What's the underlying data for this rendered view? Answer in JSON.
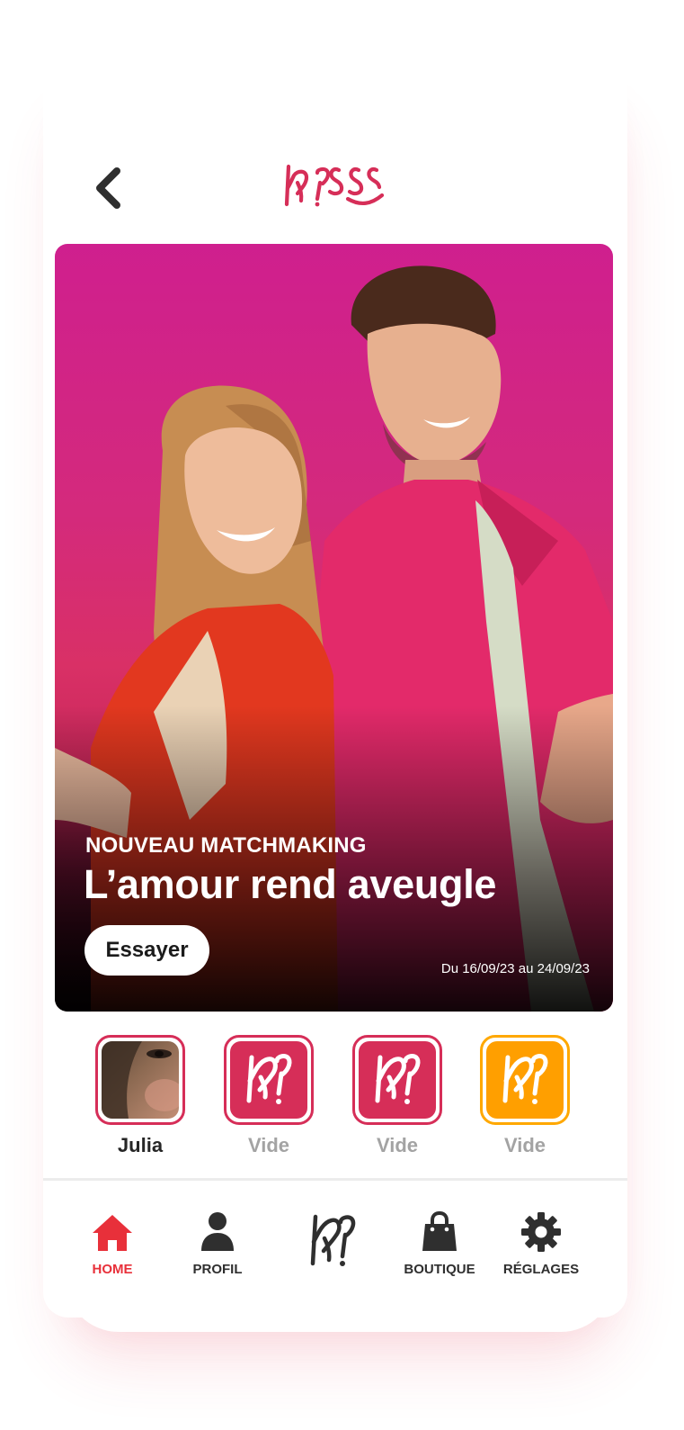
{
  "app": {
    "brand": "KISS"
  },
  "colors": {
    "brand_pink": "#d62e58",
    "active_red": "#e8303a",
    "icon_dark": "#2f2f2f",
    "muted_gray": "#a3a3a3",
    "slot_orange": "#ff9f00"
  },
  "header": {
    "back_icon": "chevron-left-icon",
    "logo_icon": "kiss-logo"
  },
  "banner": {
    "kicker": "NOUVEAU MATCHMAKING",
    "headline": "L’amour rend aveugle",
    "cta_label": "Essayer",
    "dates": "Du 16/09/23 au 24/09/23"
  },
  "slots": [
    {
      "label": "Julia",
      "type": "photo"
    },
    {
      "label": "Vide",
      "type": "empty"
    },
    {
      "label": "Vide",
      "type": "empty"
    },
    {
      "label": "Vide",
      "type": "empty-orange"
    }
  ],
  "nav": {
    "items": [
      {
        "label": "HOME",
        "icon": "home-icon",
        "active": true
      },
      {
        "label": "PROFIL",
        "icon": "user-icon",
        "active": false
      },
      {
        "label": "",
        "icon": "kiss-logo-icon",
        "active": false
      },
      {
        "label": "BOUTIQUE",
        "icon": "shopping-bag-icon",
        "active": false
      },
      {
        "label": "RÉGLAGES",
        "icon": "gear-icon",
        "active": false
      }
    ]
  }
}
